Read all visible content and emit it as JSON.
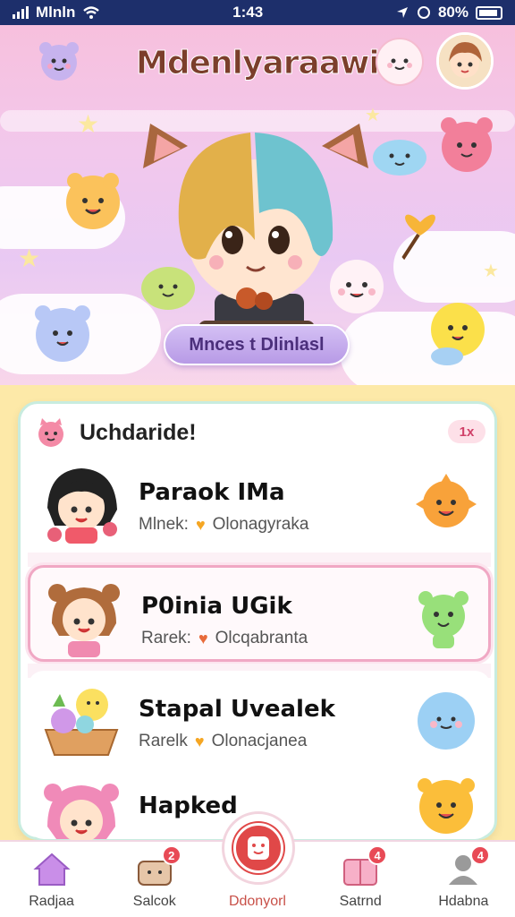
{
  "status_bar": {
    "carrier": "Mlnln",
    "time": "1:43",
    "battery": "80%"
  },
  "header": {
    "title": "Mdenlyaraawi"
  },
  "hero": {
    "cta_label": "Mnces t Dlinlasl"
  },
  "panel": {
    "title": "Uchdaride!",
    "badge": "1x",
    "items": [
      {
        "name": "Paraok IMa",
        "sub_left": "Mlnek:",
        "sub_right": "Olonagyraka"
      },
      {
        "name": "P0inia UGik",
        "sub_left": "Rarek:",
        "sub_right": "Olcqabranta"
      },
      {
        "name": "Stapal Uvealek",
        "sub_left": "Rarelk",
        "sub_right": "Olonacjanea"
      },
      {
        "name": "Hapked",
        "sub_left": "",
        "sub_right": ""
      }
    ]
  },
  "tabbar": {
    "tabs": [
      {
        "label": "Radjaa",
        "count": ""
      },
      {
        "label": "Salcok",
        "count": "2"
      },
      {
        "label": "Ddonyorl",
        "count": ""
      },
      {
        "label": "Satrnd",
        "count": "4"
      },
      {
        "label": "Hdabna",
        "count": "4"
      }
    ]
  },
  "colors": {
    "status_bar": "#1d2f6b",
    "hero_pink": "#f7c0dd",
    "accent_red": "#e04848",
    "cta_purple": "#b79ae6",
    "panel_border": "#c8ecdf",
    "selected_border": "#f0a8c4",
    "background_yellow": "#fde9a8"
  },
  "icons": [
    "wifi-icon",
    "location-icon",
    "battery-icon",
    "home-icon",
    "box-icon",
    "smile-icon",
    "gift-box-icon",
    "profile-icon",
    "heart-icon"
  ]
}
